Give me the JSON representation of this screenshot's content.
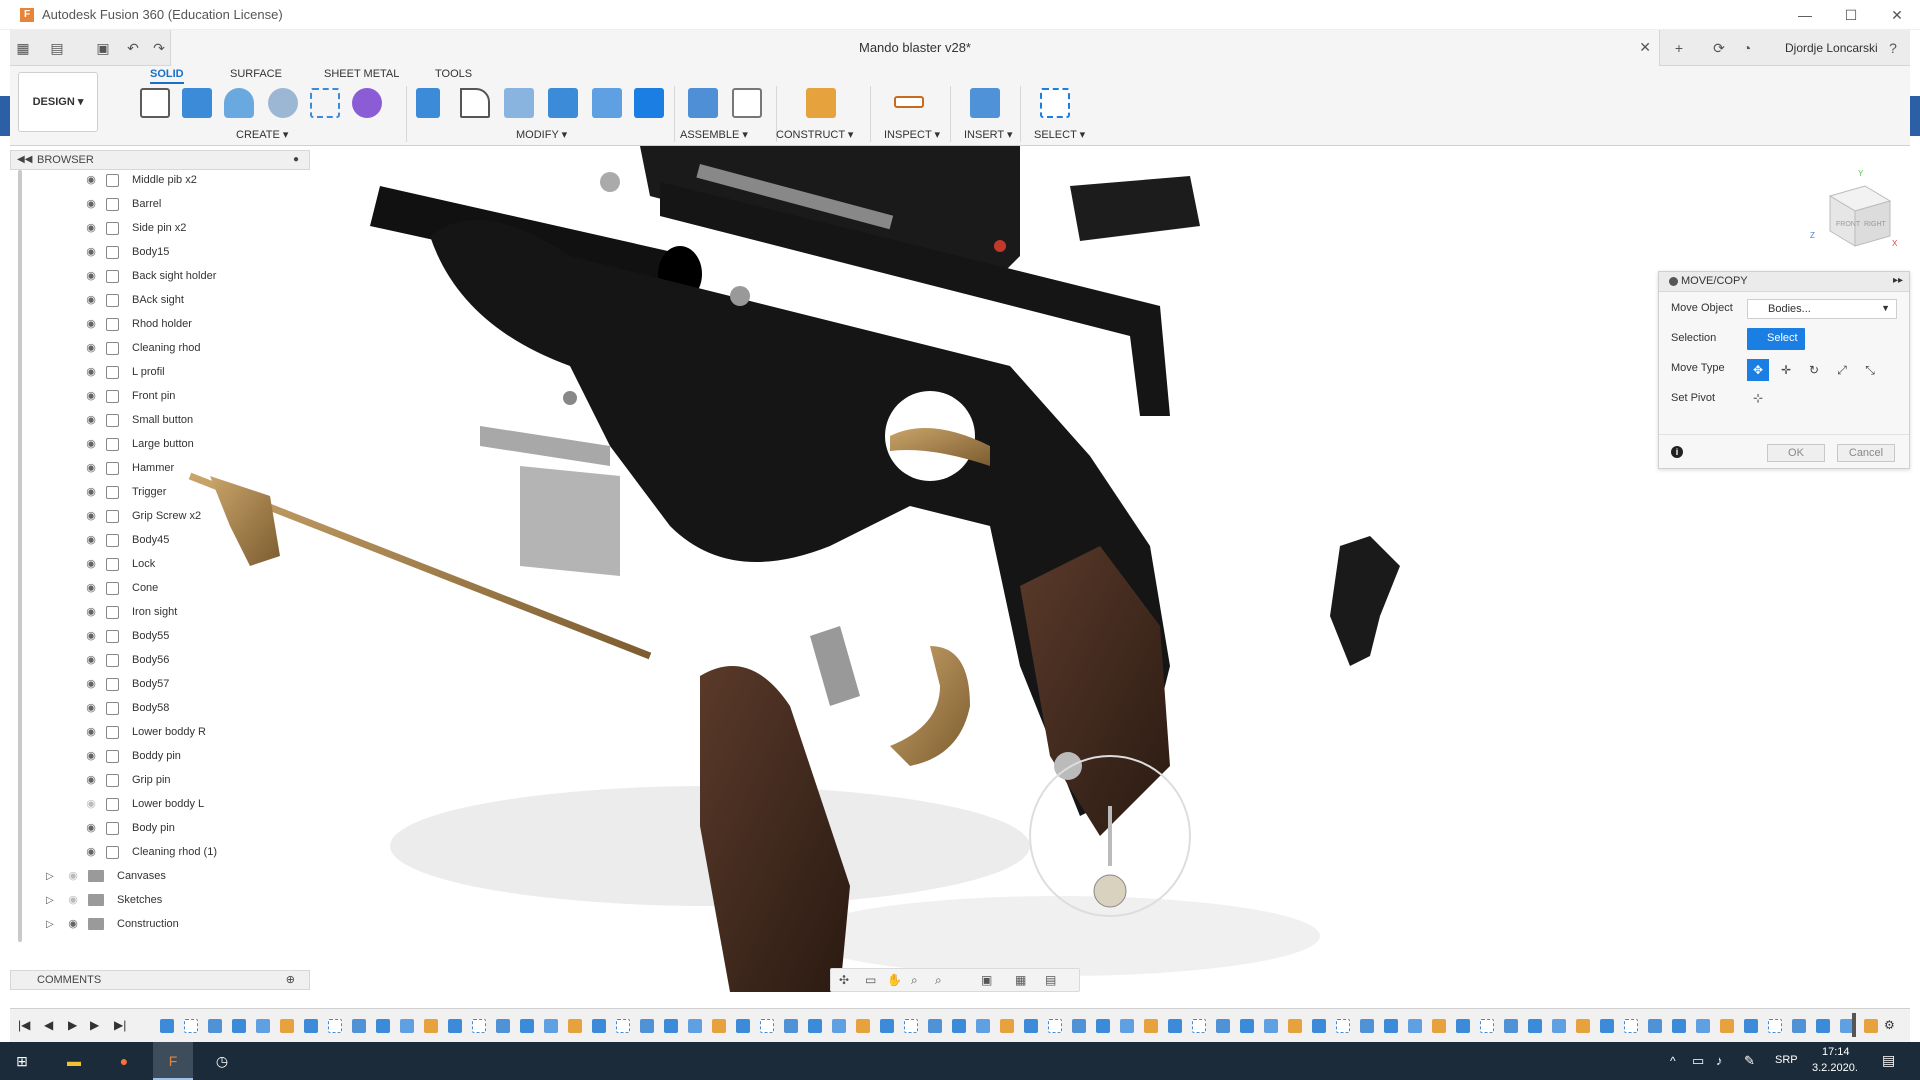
{
  "window": {
    "title": "Autodesk Fusion 360 (Education License)",
    "controls": [
      "—",
      "☐",
      "✕"
    ]
  },
  "document": {
    "title": "Mando blaster v28*",
    "close": "✕"
  },
  "user": {
    "name": "Djordje Loncarski"
  },
  "workspace": {
    "label": "DESIGN ▾"
  },
  "ribbon": {
    "tabs": [
      "SOLID",
      "SURFACE",
      "SHEET METAL",
      "TOOLS"
    ],
    "active_tab": "SOLID",
    "groups": [
      "CREATE ▾",
      "MODIFY ▾",
      "ASSEMBLE ▾",
      "CONSTRUCT ▾",
      "INSPECT ▾",
      "INSERT ▾",
      "SELECT ▾"
    ],
    "accent": "#1a7ee2"
  },
  "browser": {
    "title": "BROWSER",
    "items": [
      "Middle pib x2",
      "Barrel",
      "Side pin x2",
      "Body15",
      "Back sight holder",
      "BAck sight",
      "Rhod holder",
      "Cleaning rhod",
      "L profil",
      "Front pin",
      "Small button",
      "Large button",
      "Hammer",
      "Trigger",
      "Grip Screw x2",
      "Body45",
      "Lock",
      "Cone",
      "Iron sight",
      "Body55",
      "Body56",
      "Body57",
      "Body58",
      "Lower boddy R",
      "Boddy pin",
      "Grip pin",
      "Lower boddy L",
      "Body pin",
      "Cleaning rhod (1)"
    ],
    "folders": [
      "Canvases",
      "Sketches",
      "Construction"
    ]
  },
  "comments": {
    "title": "COMMENTS"
  },
  "dialog": {
    "title": "MOVE/COPY",
    "move_object_label": "Move Object",
    "move_object_value": "Bodies...",
    "selection_label": "Selection",
    "selection_button": "Select",
    "move_type_label": "Move Type",
    "set_pivot_label": "Set Pivot",
    "ok": "OK",
    "cancel": "Cancel"
  },
  "viewcube": {
    "faces": [
      "FRONT",
      "RIGHT"
    ],
    "axes": [
      "Y",
      "Z",
      "X"
    ]
  },
  "taskbar": {
    "time": "17:14",
    "date": "3.2.2020.",
    "lang": "SRP"
  }
}
